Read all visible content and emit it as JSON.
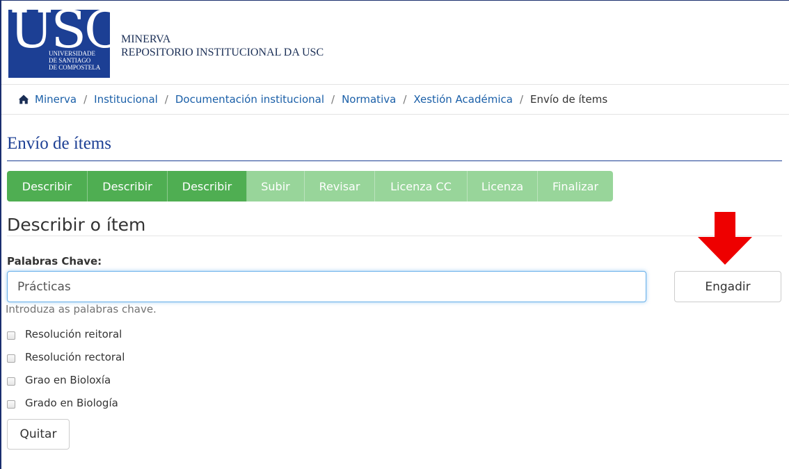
{
  "header": {
    "logo_letters": "USC",
    "logo_sub": [
      "UNIVERSIDADE",
      "DE SANTIAGO",
      "DE COMPOSTELA"
    ],
    "repo_name": "MINERVA",
    "repo_subtitle": "REPOSITORIO INSTITUCIONAL DA USC"
  },
  "breadcrumb": {
    "items": [
      "Minerva",
      "Institucional",
      "Documentación institucional",
      "Normativa",
      "Xestión Académica"
    ],
    "current": "Envío de ítems",
    "separator": "/"
  },
  "page_title": "Envío de ítems",
  "progress": {
    "steps": [
      {
        "label": "Describir",
        "state": "done"
      },
      {
        "label": "Describir",
        "state": "done"
      },
      {
        "label": "Describir",
        "state": "done"
      },
      {
        "label": "Subir",
        "state": "todo"
      },
      {
        "label": "Revisar",
        "state": "todo"
      },
      {
        "label": "Licenza CC",
        "state": "todo"
      },
      {
        "label": "Licenza",
        "state": "todo"
      },
      {
        "label": "Finalizar",
        "state": "todo"
      }
    ]
  },
  "section_heading": "Describir o ítem",
  "keywords": {
    "label": "Palabras Chave:",
    "value": "Prácticas",
    "help": "Introduza as palabras chave.",
    "add_label": "Engadir",
    "options": [
      "Resolución reitoral",
      "Resolución rectoral",
      "Grao en Bioloxía",
      "Grado en Biología"
    ],
    "remove_label": "Quitar"
  },
  "colors": {
    "brand_blue": "#1c3f94",
    "link_blue": "#1a5fa8",
    "step_done": "#4fae52",
    "step_todo": "#98d59a",
    "arrow_red": "#ee0000"
  }
}
